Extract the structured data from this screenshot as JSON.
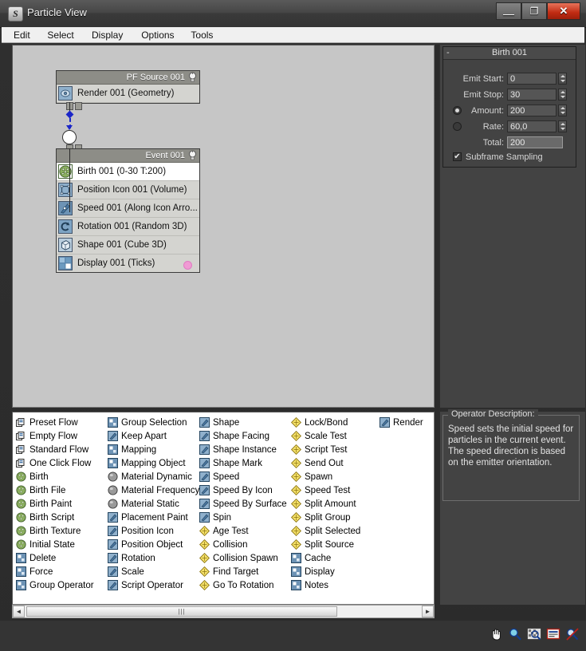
{
  "window": {
    "title": "Particle View",
    "app_icon": "particle-view-icon",
    "controls": {
      "minimize": "—",
      "maximize": "❐",
      "close": "✕"
    }
  },
  "menubar": {
    "items": [
      {
        "label": "Edit",
        "name": "menu-edit"
      },
      {
        "label": "Select",
        "name": "menu-select"
      },
      {
        "label": "Display",
        "name": "menu-display"
      },
      {
        "label": "Options",
        "name": "menu-options"
      },
      {
        "label": "Tools",
        "name": "menu-tools"
      }
    ]
  },
  "canvas": {
    "nodes": [
      {
        "title": "PF Source 001",
        "name": "node-pf-source-001",
        "rows": [
          {
            "label": "Render 001 (Geometry)",
            "icon": "render-icon",
            "selected": false,
            "dot": false
          }
        ]
      },
      {
        "title": "Event 001",
        "name": "node-event-001",
        "rows": [
          {
            "label": "Birth 001 (0-30 T:200)",
            "icon": "birth-icon",
            "selected": true,
            "dot": false
          },
          {
            "label": "Position Icon 001 (Volume)",
            "icon": "position-icon",
            "selected": false,
            "dot": false
          },
          {
            "label": "Speed 001 (Along Icon Arro...",
            "icon": "speed-icon",
            "selected": false,
            "dot": false
          },
          {
            "label": "Rotation 001 (Random 3D)",
            "icon": "rotation-icon",
            "selected": false,
            "dot": false
          },
          {
            "label": "Shape 001 (Cube 3D)",
            "icon": "shape-icon",
            "selected": false,
            "dot": false
          },
          {
            "label": "Display 001 (Ticks)",
            "icon": "display-icon",
            "selected": false,
            "dot": true
          }
        ]
      }
    ]
  },
  "param_panel": {
    "rollout_title": "Birth 001",
    "collapse_glyph": "-",
    "fields": [
      {
        "label": "Emit Start:",
        "value": "0",
        "name": "emit-start"
      },
      {
        "label": "Emit Stop:",
        "value": "30",
        "name": "emit-stop"
      },
      {
        "label": "Amount:",
        "value": "200",
        "name": "amount"
      },
      {
        "label": "Rate:",
        "value": "60,0",
        "name": "rate"
      },
      {
        "label": "Total:",
        "value": "200",
        "name": "total"
      }
    ],
    "radio_amount_selected": true,
    "checkbox": {
      "label": "Subframe Sampling",
      "checked": true,
      "mark": "✔"
    }
  },
  "depot": {
    "columns": [
      {
        "items": [
          {
            "label": "Preset Flow",
            "icon": "preset-flow-icon",
            "type": "flow"
          },
          {
            "label": "Empty Flow",
            "icon": "empty-flow-icon",
            "type": "flow"
          },
          {
            "label": "Standard Flow",
            "icon": "standard-flow-icon",
            "type": "flow"
          },
          {
            "label": "One Click Flow",
            "icon": "one-click-flow-icon",
            "type": "flow"
          },
          {
            "label": "Birth",
            "icon": "birth-icon",
            "type": "green"
          },
          {
            "label": "Birth File",
            "icon": "birth-file-icon",
            "type": "green"
          },
          {
            "label": "Birth Paint",
            "icon": "birth-paint-icon",
            "type": "green"
          },
          {
            "label": "Birth Script",
            "icon": "birth-script-icon",
            "type": "green"
          },
          {
            "label": "Birth Texture",
            "icon": "birth-texture-icon",
            "type": "green"
          },
          {
            "label": "Initial State",
            "icon": "initial-state-icon",
            "type": "green"
          },
          {
            "label": "Delete",
            "icon": "delete-icon",
            "type": "square"
          },
          {
            "label": "Force",
            "icon": "force-icon",
            "type": "square"
          },
          {
            "label": "Group Operator",
            "icon": "group-operator-icon",
            "type": "square"
          }
        ]
      },
      {
        "items": [
          {
            "label": "Group Selection",
            "icon": "group-selection-icon",
            "type": "square"
          },
          {
            "label": "Keep Apart",
            "icon": "keep-apart-icon",
            "type": "blue"
          },
          {
            "label": "Mapping",
            "icon": "mapping-icon",
            "type": "square"
          },
          {
            "label": "Mapping Object",
            "icon": "mapping-object-icon",
            "type": "square"
          },
          {
            "label": "Material Dynamic",
            "icon": "material-dynamic-icon",
            "type": "sphere"
          },
          {
            "label": "Material Frequency",
            "icon": "material-frequency-icon",
            "type": "sphere"
          },
          {
            "label": "Material Static",
            "icon": "material-static-icon",
            "type": "sphere"
          },
          {
            "label": "Placement Paint",
            "icon": "placement-paint-icon",
            "type": "blue"
          },
          {
            "label": "Position Icon",
            "icon": "position-icon",
            "type": "blue"
          },
          {
            "label": "Position Object",
            "icon": "position-object-icon",
            "type": "blue"
          },
          {
            "label": "Rotation",
            "icon": "rotation-icon",
            "type": "blue"
          },
          {
            "label": "Scale",
            "icon": "scale-icon",
            "type": "blue"
          },
          {
            "label": "Script Operator",
            "icon": "script-operator-icon",
            "type": "blue"
          }
        ]
      },
      {
        "items": [
          {
            "label": "Shape",
            "icon": "shape-icon",
            "type": "blue"
          },
          {
            "label": "Shape Facing",
            "icon": "shape-facing-icon",
            "type": "blue"
          },
          {
            "label": "Shape Instance",
            "icon": "shape-instance-icon",
            "type": "blue"
          },
          {
            "label": "Shape Mark",
            "icon": "shape-mark-icon",
            "type": "blue"
          },
          {
            "label": "Speed",
            "icon": "speed-icon",
            "type": "blue"
          },
          {
            "label": "Speed By Icon",
            "icon": "speed-by-icon-icon",
            "type": "blue"
          },
          {
            "label": "Speed By Surface",
            "icon": "speed-by-surface-icon",
            "type": "blue"
          },
          {
            "label": "Spin",
            "icon": "spin-icon",
            "type": "blue"
          },
          {
            "label": "Age Test",
            "icon": "age-test-icon",
            "type": "diamond"
          },
          {
            "label": "Collision",
            "icon": "collision-icon",
            "type": "diamond"
          },
          {
            "label": "Collision Spawn",
            "icon": "collision-spawn-icon",
            "type": "diamond"
          },
          {
            "label": "Find Target",
            "icon": "find-target-icon",
            "type": "diamond"
          },
          {
            "label": "Go To Rotation",
            "icon": "go-to-rotation-icon",
            "type": "diamond"
          }
        ]
      },
      {
        "items": [
          {
            "label": "Lock/Bond",
            "icon": "lock-bond-icon",
            "type": "diamond"
          },
          {
            "label": "Scale Test",
            "icon": "scale-test-icon",
            "type": "diamond"
          },
          {
            "label": "Script Test",
            "icon": "script-test-icon",
            "type": "diamond"
          },
          {
            "label": "Send Out",
            "icon": "send-out-icon",
            "type": "diamond"
          },
          {
            "label": "Spawn",
            "icon": "spawn-icon",
            "type": "diamond"
          },
          {
            "label": "Speed Test",
            "icon": "speed-test-icon",
            "type": "diamond"
          },
          {
            "label": "Split Amount",
            "icon": "split-amount-icon",
            "type": "diamond"
          },
          {
            "label": "Split Group",
            "icon": "split-group-icon",
            "type": "diamond"
          },
          {
            "label": "Split Selected",
            "icon": "split-selected-icon",
            "type": "diamond"
          },
          {
            "label": "Split Source",
            "icon": "split-source-icon",
            "type": "diamond"
          },
          {
            "label": "Cache",
            "icon": "cache-icon",
            "type": "square"
          },
          {
            "label": "Display",
            "icon": "display-icon",
            "type": "square"
          },
          {
            "label": "Notes",
            "icon": "notes-icon",
            "type": "square"
          }
        ]
      },
      {
        "items": [
          {
            "label": "Render",
            "icon": "render-icon",
            "type": "blue"
          }
        ]
      }
    ],
    "scrollbar": {
      "left_arrow": "◄",
      "right_arrow": "►",
      "grip": "|||"
    }
  },
  "operator_description": {
    "title": "Operator Description:",
    "text": "Speed sets the initial speed for particles in the current event. The speed direction is based on the emitter orientation."
  },
  "bottom_toolbar": {
    "tools": [
      {
        "name": "pan-hand-icon",
        "label": "Pan"
      },
      {
        "name": "zoom-magnifier-icon",
        "label": "Zoom"
      },
      {
        "name": "zoom-region-icon",
        "label": "Zoom Region"
      },
      {
        "name": "pan-to-fit-icon",
        "label": "Pan To Fit"
      },
      {
        "name": "no-zoom-extents-icon",
        "label": "Zoom Extents"
      }
    ]
  },
  "colors": {
    "title_bar": "#474747",
    "close_button": "#c02b12",
    "canvas_bg": "#c6c6c6",
    "node_header": "#8d8d87",
    "node_body": "#d4d4d0",
    "selected_row": "#ffffff",
    "panel_bg": "#434343",
    "wire_blue": "#1b26c8",
    "display_dot_pink": "#f09ad4",
    "depot_bg": "#ffffff"
  }
}
